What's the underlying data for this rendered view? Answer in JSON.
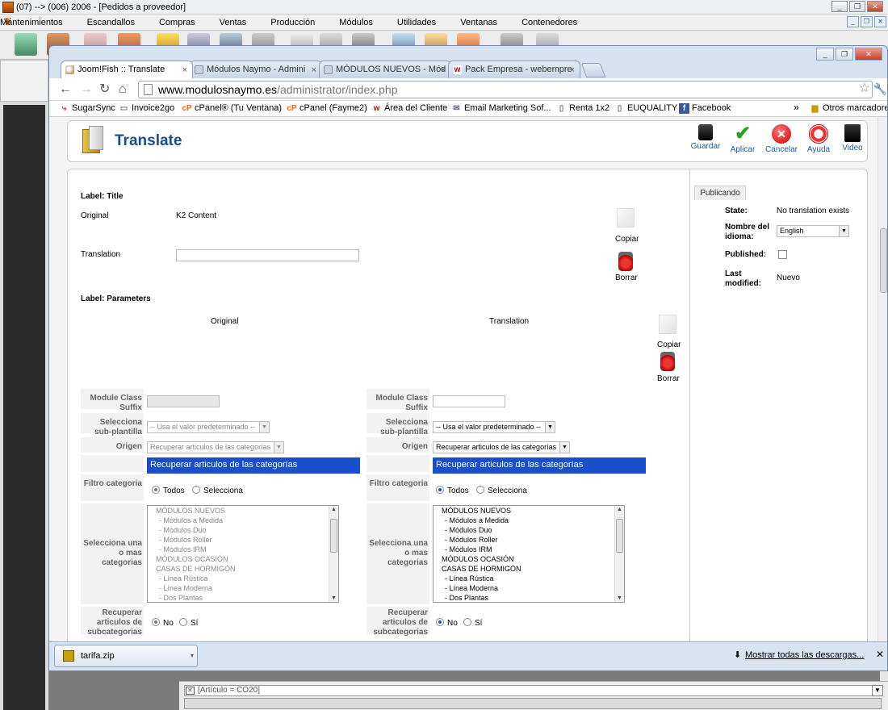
{
  "outer": {
    "title": "(07) --> (006) 2006 - [Pedidos a proveedor]",
    "menu": [
      "Mantenimientos",
      "Escandallos",
      "Compras",
      "Ventas",
      "Producción",
      "Módulos",
      "Utilidades",
      "Ventanas",
      "Contenedores"
    ],
    "status": "[Artículo = CO20]"
  },
  "browser": {
    "tabs": [
      {
        "label": "Joom!Fish :: Translate",
        "active": true
      },
      {
        "label": "Módulos Naymo - Admini",
        "active": false
      },
      {
        "label": "MÓDULOS NUEVOS - Mód",
        "active": false
      },
      {
        "label": "Pack Empresa - webempre",
        "active": false
      }
    ],
    "url_domain": "www.modulosnaymo.es",
    "url_path": "/administrator/index.php",
    "bookmarks": [
      "SugarSync",
      "Invoice2go",
      "cPanel® (Tu Ventana)",
      "cPanel (Fayme2)",
      "Área del Cliente",
      "Email Marketing Sof...",
      "Renta 1x2",
      "EUQUALITY",
      "Facebook"
    ],
    "bookmarks_more": "»",
    "other_bookmarks": "Otros marcadores"
  },
  "toolbar": {
    "title": "Translate",
    "buttons": [
      "Guardar",
      "Aplicar",
      "Cancelar",
      "Ayuda",
      "Video"
    ]
  },
  "form": {
    "label_title": "Label: Title",
    "original_label": "Original",
    "original_value": "K2 Content",
    "translation_label": "Translation",
    "copy_label": "Copiar",
    "delete_label": "Borrar",
    "label_params": "Label: Parameters",
    "col_original": "Original",
    "col_translation": "Translation",
    "fields": {
      "module_class_suffix": "Module Class Suffix",
      "subtemplate": "Selecciona sub-plantilla",
      "origen": "Origen",
      "filtro": "Filtro categoria",
      "selecciona_categorias": "Selecciona una o mas categorias",
      "recuperar_sub": "Recuperar articulos de subcategorias"
    },
    "subtemplate_value": "-- Usa el valor predeterminado --",
    "origen_value": "Recuperar articulos de las categorías",
    "origen_bar": "Recuperar articulos de las categorías",
    "filtro_options": [
      "Todos",
      "Selecciona"
    ],
    "yes_no": [
      "No",
      "Sí"
    ],
    "categories": [
      {
        "text": "MÓDULOS NUEVOS",
        "sub": false
      },
      {
        "text": "- Módulos a Medida",
        "sub": true
      },
      {
        "text": "- Módulos Duo",
        "sub": true
      },
      {
        "text": "- Módulos Roller",
        "sub": true
      },
      {
        "text": "- Módulos IRM",
        "sub": true
      },
      {
        "text": "MÓDULOS OCASIÓN",
        "sub": false
      },
      {
        "text": "CASAS DE HORMIGÓN",
        "sub": false
      },
      {
        "text": "- Línea Rústica",
        "sub": true
      },
      {
        "text": "- Línea Moderna",
        "sub": true
      },
      {
        "text": "- Dos Plantas",
        "sub": true
      }
    ]
  },
  "publishing": {
    "tab": "Publicando",
    "state_label": "State:",
    "state_value": "No translation exists",
    "lang_label": "Nombre del idioma:",
    "lang_value": "English",
    "published_label": "Published:",
    "modified_label": "Last modified:",
    "modified_value": "Nuevo"
  },
  "downloads": {
    "file": "tarifa.zip",
    "show_all": "Mostrar todas las descargas..."
  }
}
